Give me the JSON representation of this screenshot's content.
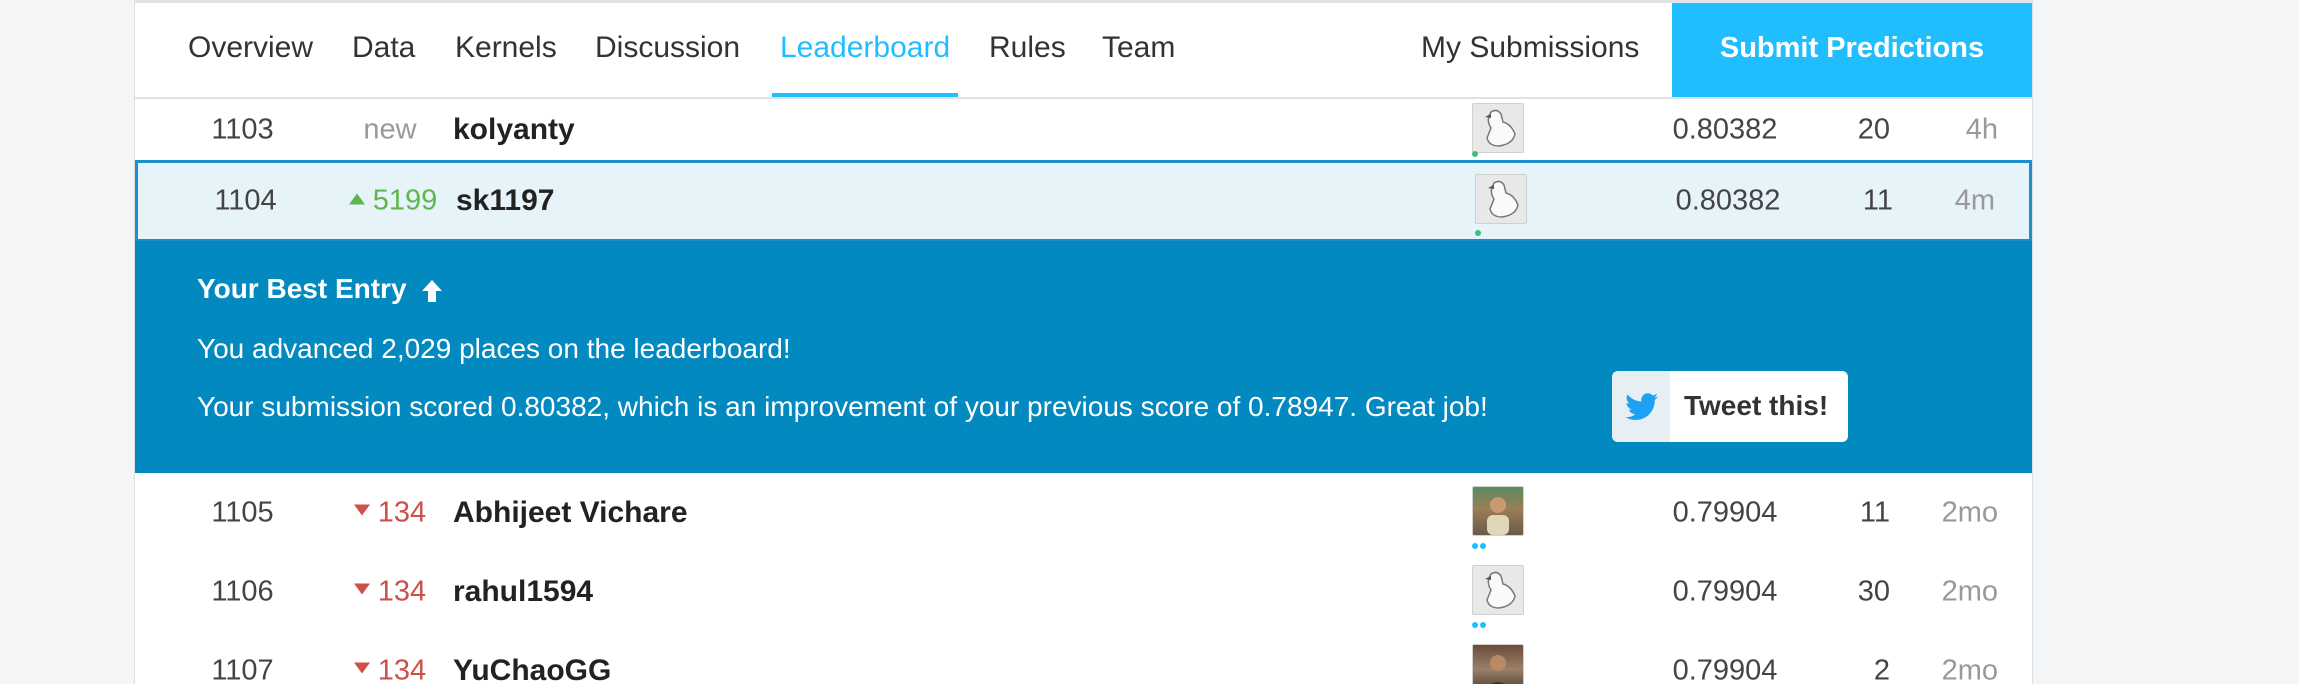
{
  "nav": {
    "tabs": [
      {
        "label": "Overview"
      },
      {
        "label": "Data"
      },
      {
        "label": "Kernels"
      },
      {
        "label": "Discussion"
      },
      {
        "label": "Leaderboard"
      },
      {
        "label": "Rules"
      },
      {
        "label": "Team"
      }
    ],
    "active_tab": "Leaderboard",
    "my_submissions": "My Submissions",
    "submit_predictions": "Submit Predictions"
  },
  "rows_above": [
    {
      "rank": "1103",
      "delta": "new",
      "delta_type": "new",
      "team": "kolyanty",
      "avatar": "goose-avatar-icon",
      "score": "0.80382",
      "entries": "20",
      "last": "4h"
    },
    {
      "rank": "1104",
      "delta": "5199",
      "delta_type": "up",
      "team": "sk1197",
      "avatar": "goose-avatar-icon",
      "score": "0.80382",
      "entries": "11",
      "last": "4m"
    }
  ],
  "best_entry": {
    "title": "Your Best Entry",
    "advanced_text": "You advanced 2,029 places on the leaderboard!",
    "score_text": "Your submission scored 0.80382, which is an improvement of your previous score of 0.78947. Great job!",
    "tweet_label": "Tweet this!"
  },
  "rows_below": [
    {
      "rank": "1105",
      "delta": "134",
      "delta_type": "down",
      "team": "Abhijeet Vichare",
      "avatar": "user-photo-avatar",
      "score": "0.79904",
      "entries": "11",
      "last": "2mo"
    },
    {
      "rank": "1106",
      "delta": "134",
      "delta_type": "down",
      "team": "rahul1594",
      "avatar": "goose-avatar-icon",
      "score": "0.79904",
      "entries": "30",
      "last": "2mo"
    },
    {
      "rank": "1107",
      "delta": "134",
      "delta_type": "down",
      "team": "YuChaoGG",
      "avatar": "user-photo-avatar",
      "score": "0.79904",
      "entries": "2",
      "last": "2mo"
    }
  ],
  "colors": {
    "accent": "#20beff",
    "banner": "#0289bf",
    "highlight_border": "#1b8fcb",
    "up": "#5fb64b",
    "down": "#cf4f4a"
  }
}
